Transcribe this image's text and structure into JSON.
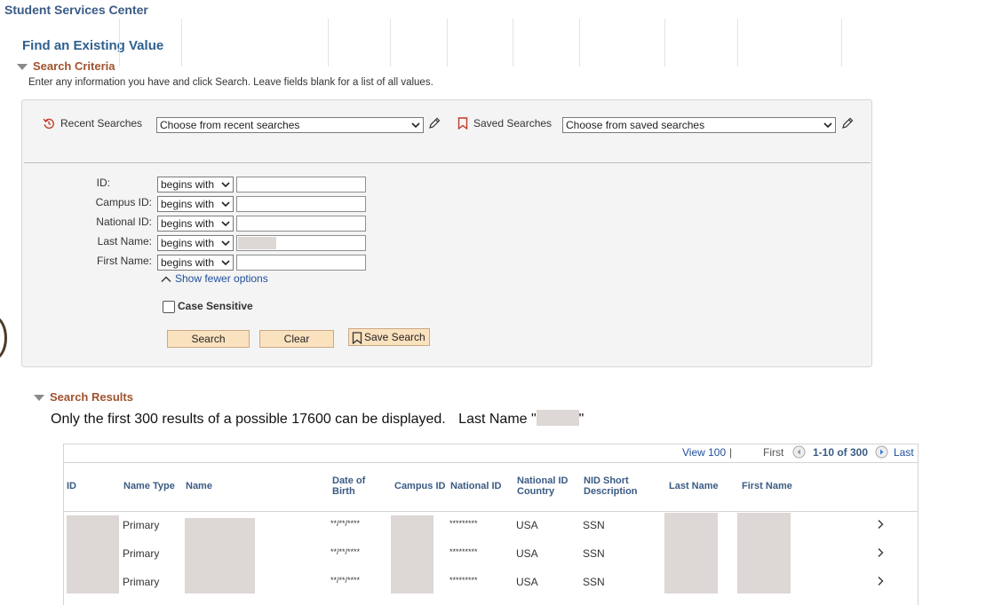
{
  "page": {
    "title": "Student Services Center"
  },
  "find": {
    "title": "Find an Existing Value",
    "section_label": "Search Criteria",
    "instructions": "Enter any information you have and click Search. Leave fields blank for a list of all values."
  },
  "recent": {
    "label": "Recent Searches",
    "value": "Choose from recent searches"
  },
  "saved": {
    "label": "Saved Searches",
    "value": "Choose from saved searches"
  },
  "criteria": [
    {
      "label": "ID:",
      "operator": "begins with",
      "value": ""
    },
    {
      "label": "Campus ID:",
      "operator": "begins with",
      "value": ""
    },
    {
      "label": "National ID:",
      "operator": "begins with",
      "value": ""
    },
    {
      "label": "Last Name:",
      "operator": "begins with",
      "value": ""
    },
    {
      "label": "First Name:",
      "operator": "begins with",
      "value": ""
    }
  ],
  "fewer_options": "Show fewer options",
  "case_sensitive": "Case Sensitive",
  "buttons": {
    "search": "Search",
    "clear": "Clear",
    "save_search": "Save Search"
  },
  "results": {
    "section_label": "Search Results",
    "summary": "Only the first 300 results of a possible 17600 can be displayed.",
    "summary_filter": "Last Name \"",
    "summary_filter_end": "\"",
    "nav": {
      "view_all": "View 100",
      "first": "First",
      "range": "1-10 of 300",
      "last": "Last"
    },
    "columns": [
      "ID",
      "Name Type",
      "Name",
      "Date of Birth",
      "Campus ID",
      "National ID",
      "National ID Country",
      "NID Short Description",
      "Last Name",
      "First Name"
    ],
    "rows": [
      {
        "name_type": "Primary",
        "dob": "**/**/****",
        "national_id": "*********",
        "country": "USA",
        "nid_desc": "SSN"
      },
      {
        "name_type": "Primary",
        "dob": "**/**/****",
        "national_id": "*********",
        "country": "USA",
        "nid_desc": "SSN"
      },
      {
        "name_type": "Primary",
        "dob": "**/**/****",
        "national_id": "*********",
        "country": "USA",
        "nid_desc": "SSN"
      }
    ]
  },
  "colors": {
    "title_blue": "#3a5b84",
    "section_brown": "#a0522d",
    "button_tan": "#fbe2bf",
    "link_blue": "#1f4e9b"
  }
}
